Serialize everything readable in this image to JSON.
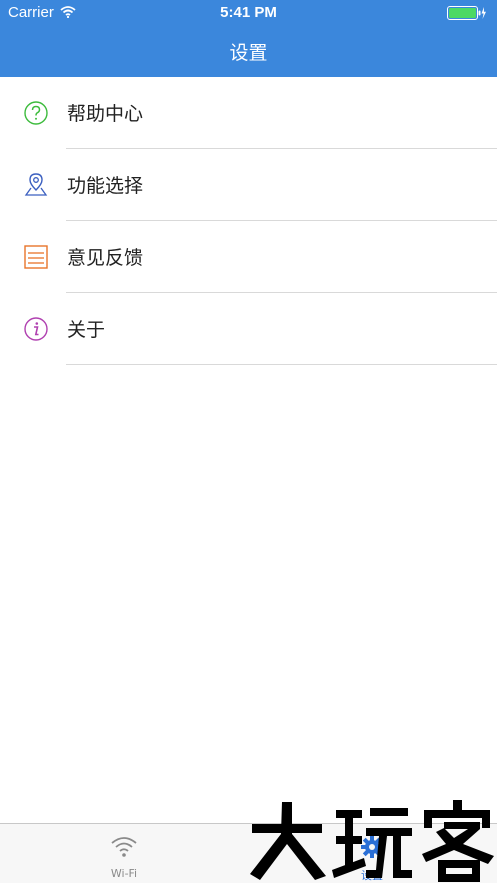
{
  "status_bar": {
    "carrier": "Carrier",
    "time": "5:41 PM",
    "battery_level": 1.0
  },
  "nav": {
    "title": "设置"
  },
  "menu": {
    "items": [
      {
        "label": "帮助中心",
        "icon": "help-question-icon",
        "color": "#3cbb3c"
      },
      {
        "label": "功能选择",
        "icon": "location-pin-icon",
        "color": "#3b5fc0"
      },
      {
        "label": "意见反馈",
        "icon": "feedback-list-icon",
        "color": "#e8742a"
      },
      {
        "label": "关于",
        "icon": "info-icon",
        "color": "#b040b0"
      }
    ]
  },
  "tabs": [
    {
      "label": "Wi-Fi",
      "icon": "wifi-icon",
      "selected": false
    },
    {
      "label": "设置",
      "icon": "gear-icon",
      "selected": true
    }
  ],
  "watermark": {
    "text": "大玩家"
  },
  "colors": {
    "accent": "#3b87dc",
    "tab_selected": "#2a6fd6",
    "tab_unselected": "#8a8a8a"
  }
}
